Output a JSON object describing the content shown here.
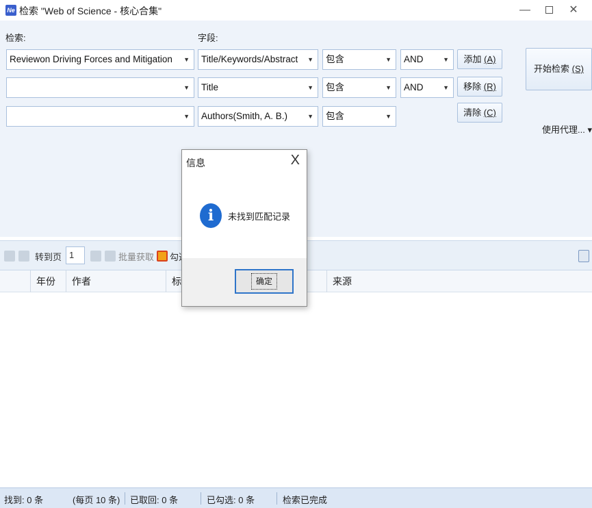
{
  "window": {
    "app_icon_text": "Ne",
    "title": "检索 \"Web of Science - 核心合集\"",
    "min": "—",
    "close": "✕"
  },
  "search": {
    "label_query": "检索:",
    "label_field": "字段:",
    "rows": [
      {
        "query": "Reviewon Driving Forces and Mitigation",
        "field": "Title/Keywords/Abstract",
        "match": "包含",
        "op": "AND"
      },
      {
        "query": "",
        "field": "Title",
        "match": "包含",
        "op": "AND"
      },
      {
        "query": "",
        "field": "Authors(Smith, A. B.)",
        "match": "包含",
        "op": ""
      }
    ],
    "add_label": "添加",
    "add_key": "(A)",
    "remove_label": "移除",
    "remove_key": "(R)",
    "clear_label": "清除",
    "clear_key": "(C)",
    "start_label": "开始检索",
    "start_key": "(S)",
    "proxy_label": "使用代理...",
    "proxy_arrow": "▾"
  },
  "toolbar": {
    "goto_label": "转到页",
    "page_value": "1",
    "batch_label": "批量获取",
    "check_label": "勾选"
  },
  "grid": {
    "columns": [
      "年份",
      "作者",
      "标",
      "来源"
    ]
  },
  "status": {
    "found": "找到: 0 条",
    "per_page": "(每页 10 条)",
    "fetched": "已取回: 0 条",
    "checked": "已勾选: 0 条",
    "state": "检索已完成"
  },
  "dialog": {
    "title": "信息",
    "close": "X",
    "icon_glyph": "i",
    "message": "未找到匹配记录",
    "ok_label": "确定"
  },
  "colors": {
    "panel": "#eef3fa",
    "accent": "#1f6bd0",
    "status_bg": "#dce7f5"
  }
}
